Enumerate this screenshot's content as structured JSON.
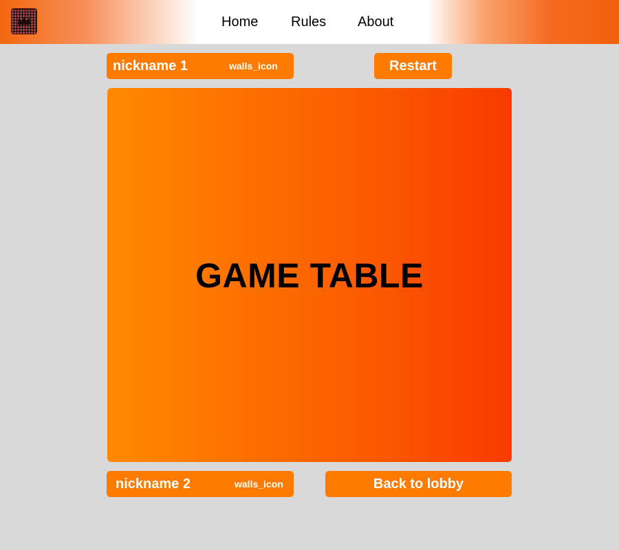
{
  "header": {
    "logo_icon": "game-board-logo-icon",
    "nav": {
      "home": "Home",
      "rules": "Rules",
      "about": "About"
    }
  },
  "players": {
    "top": {
      "nickname": "nickname 1",
      "walls": "walls_icon"
    },
    "bottom": {
      "nickname": "nickname 2",
      "walls": "walls_icon"
    }
  },
  "buttons": {
    "restart": "Restart",
    "back_to_lobby": "Back to lobby"
  },
  "game_table": {
    "label": "GAME TABLE"
  },
  "colors": {
    "accent": "#ff7b00",
    "header_orange": "#f2670f",
    "table_start": "#ff8900",
    "table_end": "#f93a00",
    "background": "#d9d9d9"
  }
}
